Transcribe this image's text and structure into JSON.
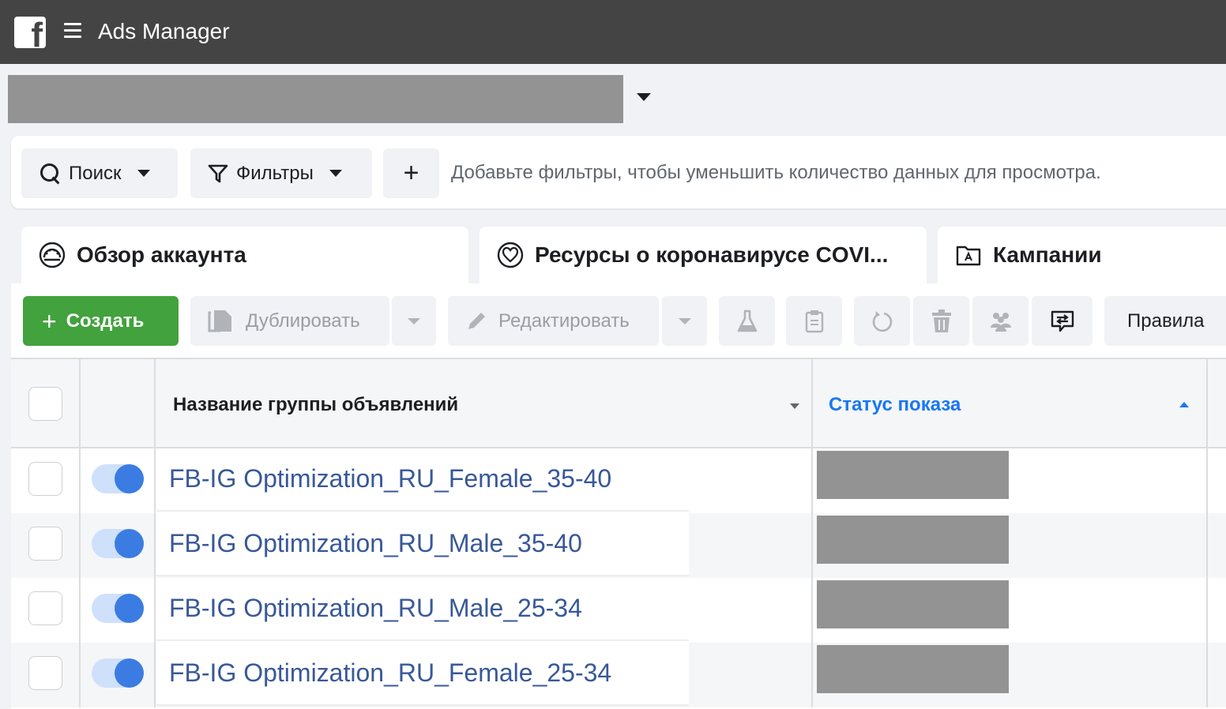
{
  "header": {
    "app_title": "Ads Manager",
    "logo_icon": "facebook-logo-icon",
    "menu_icon": "hamburger-menu-icon",
    "background": "#444444"
  },
  "filters": {
    "search_label": "Поиск",
    "filters_label": "Фильтры",
    "add_label": "+",
    "hint": "Добавьте фильтры, чтобы уменьшить количество данных для просмотра."
  },
  "tabs": [
    {
      "label": "Обзор аккаунта",
      "icon": "speedometer-icon"
    },
    {
      "label": "Ресурсы о коронавирусе COVI...",
      "icon": "heart-circle-icon"
    },
    {
      "label": "Кампании",
      "icon": "folder-icon"
    }
  ],
  "toolbar": {
    "create_label": "Создать",
    "duplicate_label": "Дублировать",
    "edit_label": "Редактировать",
    "rules_label": "Правила",
    "create_color": "#42a23d"
  },
  "table": {
    "columns": {
      "name": "Название группы объявлений",
      "status": "Статус показа"
    },
    "rows": [
      {
        "name": "FB-IG Optimization_RU_Female_35-40",
        "enabled": true
      },
      {
        "name": "FB-IG Optimization_RU_Male_35-40",
        "enabled": true
      },
      {
        "name": "FB-IG Optimization_RU_Male_25-34",
        "enabled": true
      },
      {
        "name": "FB-IG Optimization_RU_Female_25-34",
        "enabled": true
      }
    ],
    "link_color": "#385898",
    "sorted_column_color": "#1877f2"
  }
}
